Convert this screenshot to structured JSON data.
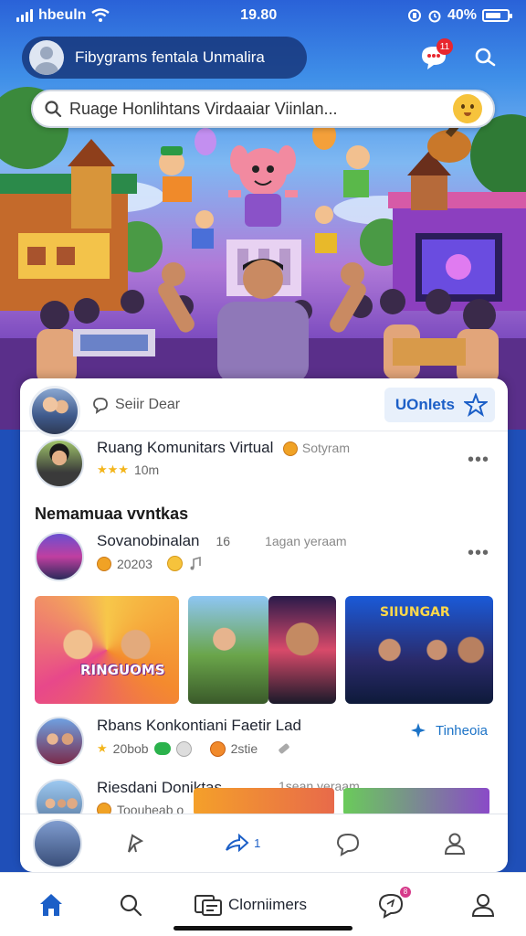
{
  "status_bar": {
    "carrier": "hbeuln",
    "time": "19.80",
    "battery": "40%"
  },
  "header": {
    "title": "Fibygrams fentala Unmalira",
    "notification_count": "11"
  },
  "search": {
    "placeholder": "Ruage Honlihtans Virdaaiar Viinlan..."
  },
  "card": {
    "comment_hint": "Seiir Dear",
    "vote_label": "UOnlets"
  },
  "post1": {
    "title": "Ruang Komunitars Virtual",
    "extra": "Sotyram",
    "meta": "10m"
  },
  "section": {
    "title": "Nemamuaa vvntkas"
  },
  "post2": {
    "title": "Sovanobinalan",
    "aside": "16",
    "time": "1agan yeraam",
    "meta": "20203"
  },
  "thumbs": [
    {
      "label": "RINGUOMS",
      "kind": "friends"
    },
    {
      "label": "",
      "kind": "park"
    },
    {
      "label": "",
      "kind": "man"
    },
    {
      "label": "SIIUNGAR",
      "kind": "studio"
    }
  ],
  "post3": {
    "title": "Rbans Konkontiani Faetir Lad",
    "tag": "Tinheoia",
    "meta1": "20bob",
    "meta2": "2stie"
  },
  "post4": {
    "title": "Riesdani Doniktas",
    "time": "1sean yeraam",
    "meta": "Toouheab o"
  },
  "action_bar": {
    "share_count": "1"
  },
  "bottom_nav": {
    "center_label": "Clorniimers",
    "message_badge": "8"
  },
  "colors": {
    "accent": "#1c5fc7",
    "badge": "#e8262e",
    "star": "#f3b51b"
  }
}
